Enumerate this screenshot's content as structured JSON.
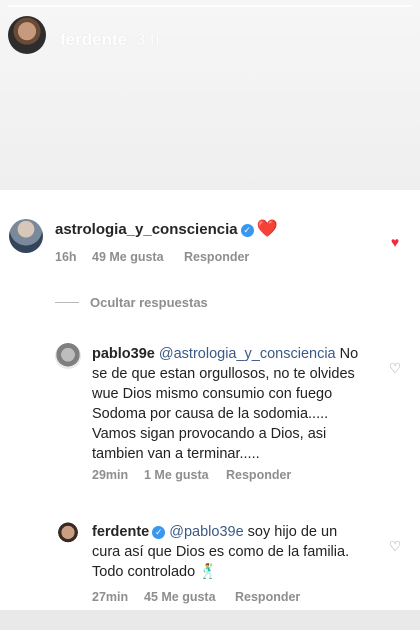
{
  "story": {
    "username": "ferdente",
    "time": "3 h"
  },
  "comments": [
    {
      "username": "astrologia_y_consciencia",
      "verified": true,
      "emoji": "❤️",
      "time": "16h",
      "likes": "49 Me gusta",
      "reply": "Responder",
      "liked": true
    },
    {
      "username": "pablo39e",
      "mention": "@astrologia_y_consciencia",
      "lines": [
        "No",
        "se de que estan orgullosos, no te olvides",
        "wue Dios mismo consumio con fuego",
        "Sodoma por causa de la sodomia.....",
        "Vamos sigan provocando a Dios, asi",
        "tambien van a terminar....."
      ],
      "time": "29min",
      "likes": "1 Me gusta",
      "reply": "Responder",
      "liked": false
    },
    {
      "username": "ferdente",
      "verified": true,
      "mention": "@pablo39e",
      "lines": [
        "soy hijo de un",
        "cura así que Dios es como de la familia.",
        "Todo controlado"
      ],
      "emoji": "🕺",
      "time": "27min",
      "likes": "45 Me gusta",
      "reply": "Responder",
      "liked": false
    }
  ],
  "hide_replies": "Ocultar respuestas",
  "colors": {
    "accent_like": "#ed2a43",
    "meta_gray": "#8e8e8e",
    "mention": "#3a5a85"
  },
  "icons": {
    "verified": "verified-badge-icon",
    "heart": "heart-icon"
  }
}
